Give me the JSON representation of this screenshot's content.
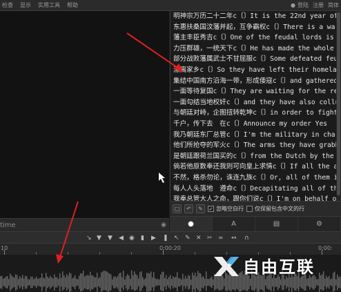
{
  "menu": {
    "items": [
      "检查",
      "显示",
      "实用工具",
      "帮助"
    ],
    "right_items": [
      "登陆",
      "注册",
      "简体"
    ]
  },
  "video": {
    "time_label": "time"
  },
  "subtitles": {
    "lines": [
      "明神宗万历二十二年c〔〕It is the 22nd year of the M",
      "东惠扶桑国汶藩并起，互争霸权c〔〕There is a war b",
      "藩主丰臣秀吉c〔〕One of the feudal lords is Toyoto",
      "力压群雄，一统天下c〔〕He has made the whole Jap",
      "部分战败藩属武士不甘屈服c〔〕Some defeated feud",
      "漂离家乡c〔〕So they have left their homeland",
      "集结中国南方沿海一带，形成倭寇c〔〕and gathered",
      "一面等待复国c〔〕They are waiting for the restorat",
      "一面勾结当地权奸c〔〕and they have also colluded",
      "与朝廷对峙，企图扭转乾坤c〔〕in order to fight aga",
      "千户，传下去　在c〔〕Announce my order Yes",
      "我乃朝廷东厂总管c〔〕I'm the military in charge of",
      "他们所抢夺的军火c〔〕The arms they have grabbed",
      "是朝廷跟荷兰国买的c〔〕from the Dutch by the imp",
      "倘若他原数奉还我则可向皇上求情c〔〕If all the arms",
      "不然，格杀勿论，诛连九族c〔〕Or, all of them inclu",
      "每人人头落地　遵命c〔〕Decapitating all of them Y",
      "我奉总管大人之命，跟你们说c〔〕I'm on behalf of m",
      "你们截劫的军火是朝廷的c〔〕The arms you have rob"
    ]
  },
  "options": {
    "ignore_blank_label": "忽略空白行",
    "ignore_blank_checked": "✓",
    "keep_chinese_label": "仅保留包含中文的行"
  },
  "tabs": {
    "tab_a_label": "A"
  },
  "ruler": {
    "labels": [
      "10",
      "0:00:20",
      "0:00:"
    ]
  },
  "watermark": {
    "text": "自由互联"
  },
  "colors": {
    "annotation_red": "#e02020",
    "background": "#1e1e1e",
    "panel": "#1b1b1b"
  }
}
